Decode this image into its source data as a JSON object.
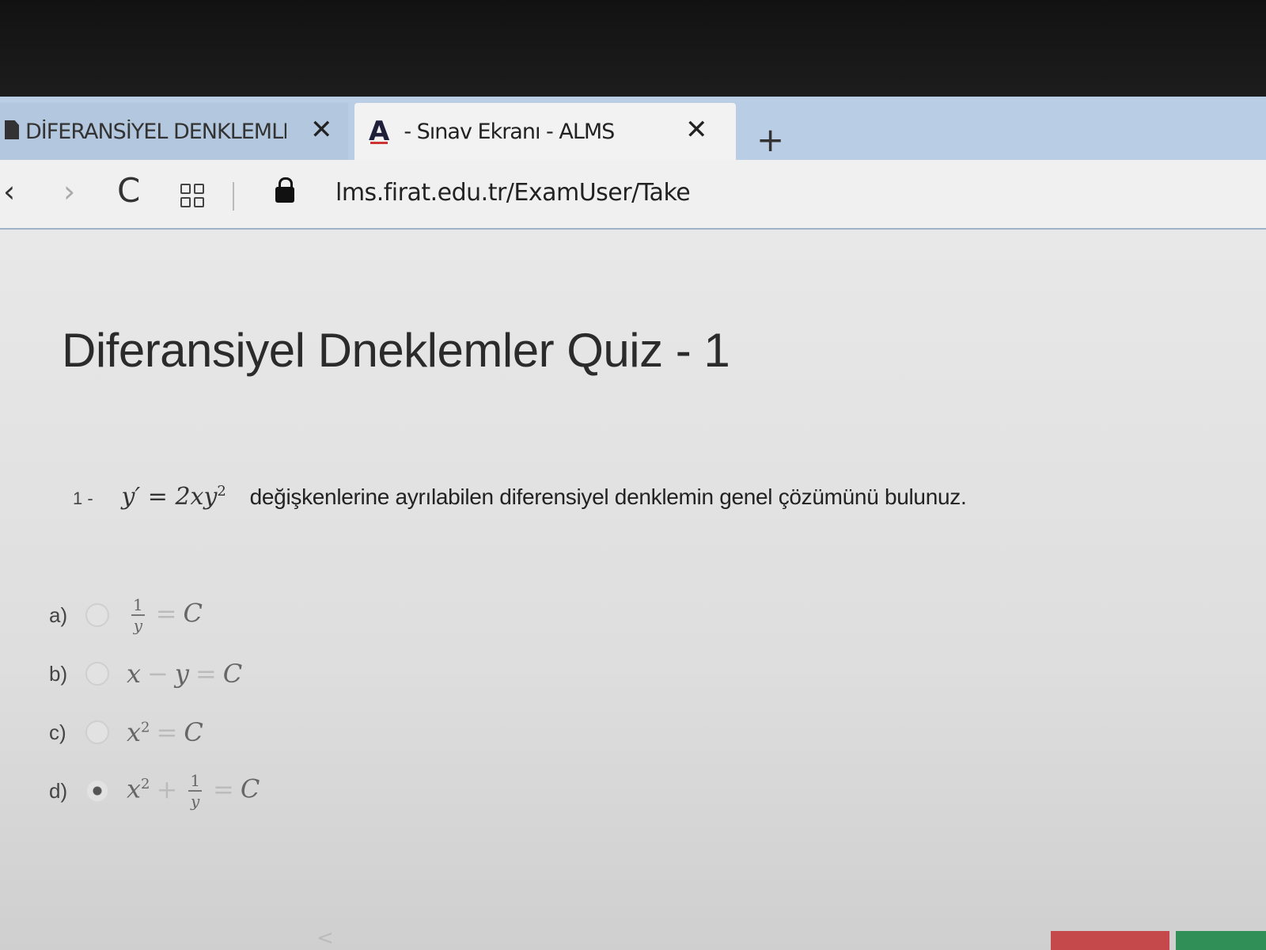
{
  "browser": {
    "tabs": [
      {
        "label": "DİFERANSİYEL DENKLEMLE",
        "active": false
      },
      {
        "label": "- Sınav Ekranı - ALMS",
        "active": true,
        "icon": "A"
      }
    ],
    "url": "lms.firat.edu.tr/ExamUser/Take"
  },
  "exam": {
    "title": "Diferansiyel Dneklemler Quiz - 1",
    "question": {
      "number": "1 -",
      "text": "değişkenlerine ayrılabilen diferensiyel denklemin genel çözümünü bulunuz."
    },
    "options": [
      {
        "letter": "a)",
        "selected": false
      },
      {
        "letter": "b)",
        "selected": false
      },
      {
        "letter": "c)",
        "selected": false
      },
      {
        "letter": "d)",
        "selected": true
      }
    ],
    "nav_prev": "<"
  },
  "colors": {
    "tabstrip": "#b9cde4",
    "submit_red": "#c5484b",
    "submit_green": "#2f8f57"
  }
}
